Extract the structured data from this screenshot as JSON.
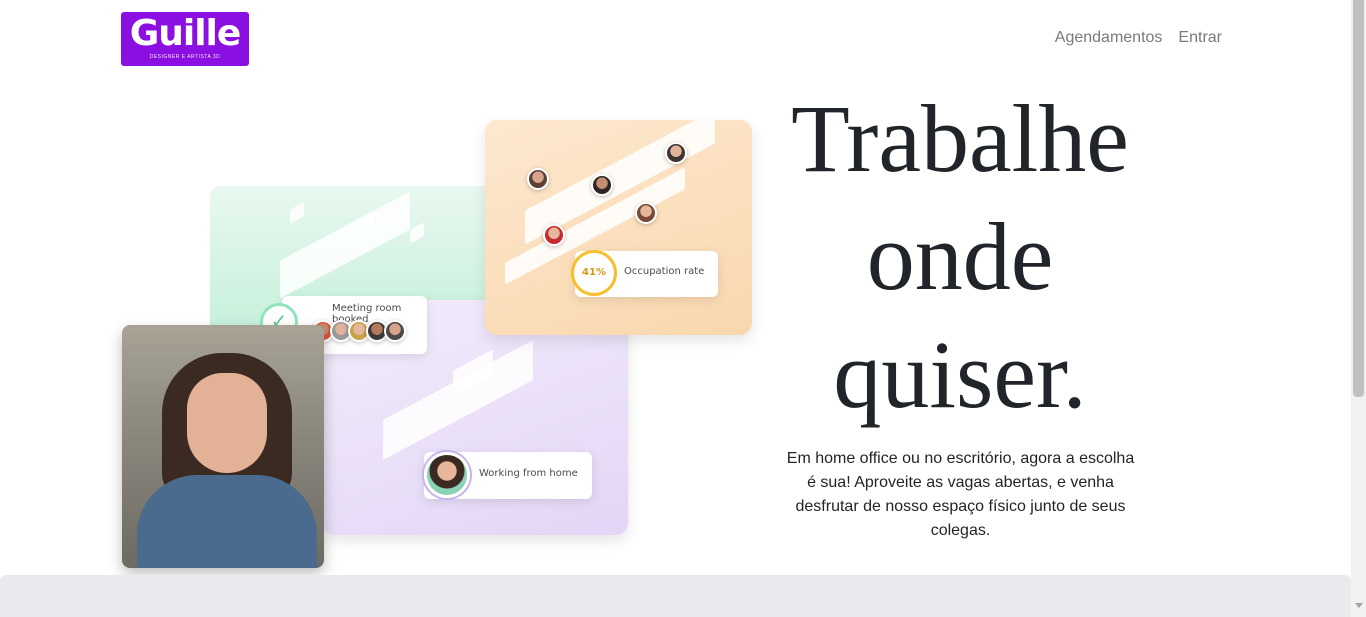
{
  "brand": {
    "logo_text": "Guille",
    "logo_tagline": "DESIGNER E ARTISTA 3D",
    "logo_color": "#8a0fe0"
  },
  "nav": {
    "items": [
      {
        "label": "Agendamentos"
      },
      {
        "label": "Entrar"
      }
    ]
  },
  "illustration": {
    "meeting_label": "Meeting room booked",
    "occupation_label": "Occupation rate",
    "occupation_value": "41%",
    "wfh_label": "Working from home"
  },
  "hero": {
    "headline": "Trabalhe onde quiser.",
    "lead": "Em home office ou no escritório, agora a escolha é sua! Aproveite as vagas abertas, e venha desfrutar de nosso espaço físico junto de seus colegas."
  },
  "colors": {
    "text": "#212529",
    "nav_link": "#7a7a7a",
    "band": "#e9eaee",
    "accent_green": "#8fe5bb",
    "accent_orange": "#f7bf2c",
    "accent_purple": "#c7b3ea"
  }
}
